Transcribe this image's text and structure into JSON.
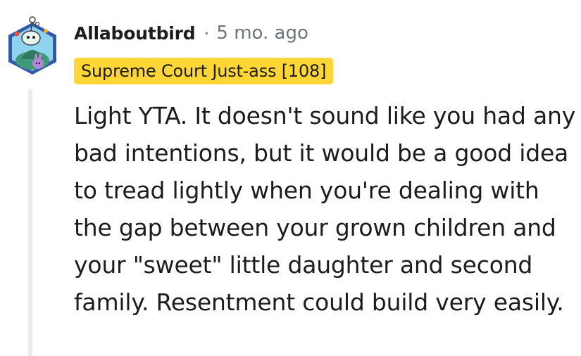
{
  "comment": {
    "avatar_icon": "snoo-avatar-icon",
    "username": "Allaboutbird",
    "separator": "·",
    "timestamp": "5 mo. ago",
    "flair": "Supreme Court Just-ass [108]",
    "body": "Light YTA. It doesn't sound like you had any bad intentions, but it would be a good idea to tread lightly when you're dealing with the gap between your grown children and your \"sweet\" little daughter and second family. Resentment could build very easily."
  },
  "colors": {
    "flair_background": "#ffd635",
    "meta_text": "#6b747a",
    "thread_line": "#eaedef"
  }
}
